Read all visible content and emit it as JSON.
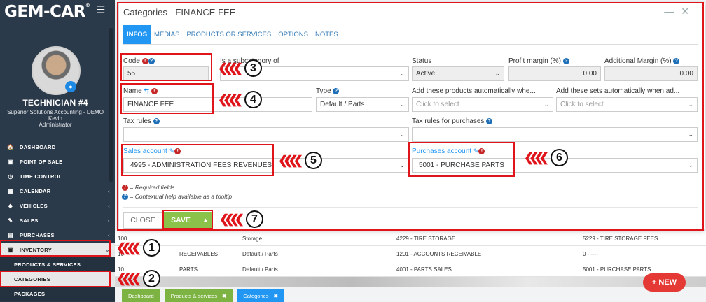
{
  "sidebar": {
    "logo": "GEM-CAR",
    "logo_mark": "®",
    "user_name": "TECHNICIAN #4",
    "company": "Superior Solutions Accounting - DEMO",
    "person": "Kevin",
    "role": "Administrator",
    "menu": [
      {
        "label": "DASHBOARD",
        "icon": "🏠"
      },
      {
        "label": "POINT OF SALE",
        "icon": "▣"
      },
      {
        "label": "TIME CONTROL",
        "icon": "◷"
      },
      {
        "label": "CALENDAR",
        "icon": "▦",
        "chev": "‹"
      },
      {
        "label": "VEHICLES",
        "icon": "◆",
        "chev": "‹"
      },
      {
        "label": "SALES",
        "icon": "✎",
        "chev": "‹"
      },
      {
        "label": "PURCHASES",
        "icon": "▤",
        "chev": "‹"
      },
      {
        "label": "INVENTORY",
        "icon": "▣",
        "chev": "⌄"
      }
    ],
    "submenu": [
      "PRODUCTS & SERVICES",
      "CATEGORIES",
      "PACKAGES"
    ]
  },
  "modal": {
    "title": "Categories - FINANCE FEE",
    "tabs": [
      "INFOS",
      "MEDIAS",
      "PRODUCTS OR SERVICES",
      "OPTIONS",
      "NOTES"
    ],
    "code_label": "Code",
    "code_value": "55",
    "subcategory_label": "Is a subcategory of",
    "status_label": "Status",
    "status_value": "Active",
    "profit_margin_label": "Profit margin (%)",
    "profit_margin_value": "0.00",
    "additional_margin_label": "Additional Margin (%)",
    "additional_margin_value": "0.00",
    "name_label": "Name",
    "name_value": "FINANCE FEE",
    "type_label": "Type",
    "type_value": "Default / Parts",
    "auto_products_label": "Add these products automatically whe...",
    "auto_products_placeholder": "Click to select",
    "auto_sets_label": "Add these sets automatically when ad...",
    "auto_sets_placeholder": "Click to select",
    "tax_rules_label": "Tax rules",
    "tax_rules_purchases_label": "Tax rules for purchases",
    "sales_account_label": "Sales account",
    "sales_account_value": "4995 - ADMINISTRATION FEES REVENUES",
    "purchases_account_label": "Purchases account",
    "purchases_account_value": "5001 - PURCHASE PARTS",
    "legend_required": "= Required fields",
    "legend_help": "= Contextual help available as a tooltip",
    "close_label": "CLOSE",
    "save_label": "SAVE"
  },
  "background": {
    "rows": [
      {
        "col1": "100",
        "col2": "Storage",
        "col3": "4229 - TIRE STORAGE",
        "col4": "5229 - TIRE STORAGE FEES"
      },
      {
        "col1": "10",
        "col2": "RECEIVABLES",
        "col3": "Default / Parts",
        "col4": "1201 - ACCOUNTS RECEIVABLE",
        "col5": "0 - ----"
      },
      {
        "col1": "10",
        "col2": "PARTS",
        "col3": "Default / Parts",
        "col4": "4001 - PARTS SALES",
        "col5": "5001 - PURCHASE PARTS"
      }
    ],
    "bottom_tabs": [
      "Dashboard",
      "Products & services",
      "Categories"
    ],
    "tab_close": "✖",
    "new_button": "+ NEW"
  },
  "annotations": [
    "1",
    "2",
    "3",
    "4",
    "5",
    "6",
    "7"
  ],
  "colors": {
    "sidebar_bg": "#2b3a4a",
    "accent_blue": "#2196f3",
    "save_green": "#8bc34a",
    "annotation_red": "#e0151b",
    "new_button_red": "#e53935"
  }
}
